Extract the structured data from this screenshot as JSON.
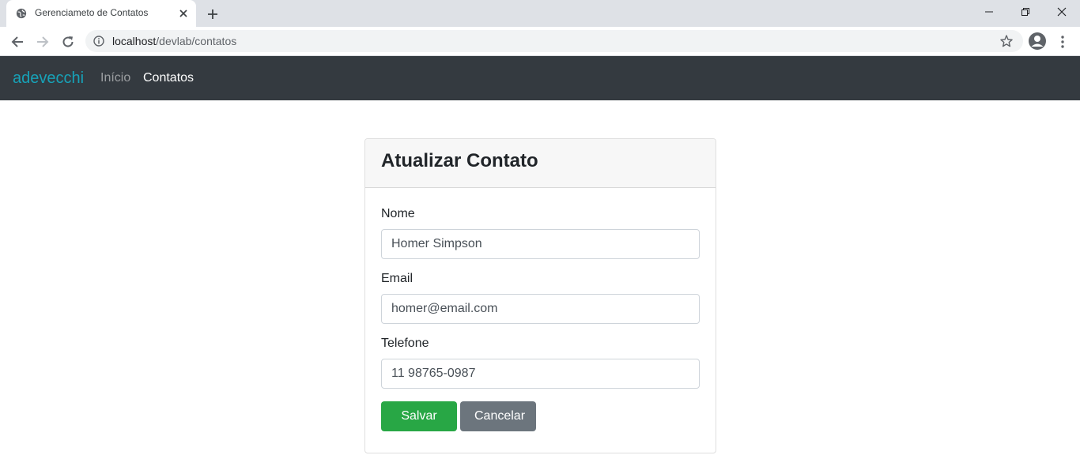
{
  "browser": {
    "tab_title": "Gerenciameto de Contatos",
    "url_host": "localhost",
    "url_path": "/devlab/contatos"
  },
  "navbar": {
    "brand": "adevecchi",
    "links": [
      {
        "label": "Início",
        "active": false
      },
      {
        "label": "Contatos",
        "active": true
      }
    ]
  },
  "card": {
    "title": "Atualizar Contato",
    "fields": {
      "nome": {
        "label": "Nome",
        "value": "Homer Simpson"
      },
      "email": {
        "label": "Email",
        "value": "homer@email.com"
      },
      "telefone": {
        "label": "Telefone",
        "value": "11 98765-0987"
      }
    },
    "buttons": {
      "save": "Salvar",
      "cancel": "Cancelar"
    }
  },
  "colors": {
    "navbar_bg": "#343a40",
    "brand": "#17a2b8",
    "success": "#28a745",
    "secondary": "#6c757d"
  }
}
